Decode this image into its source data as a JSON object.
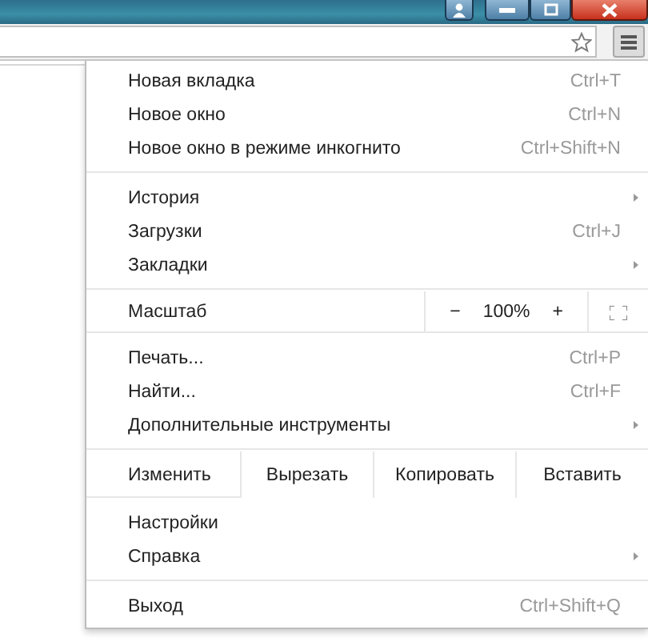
{
  "menu": {
    "groups": [
      {
        "entries": [
          {
            "kind": "item",
            "label": "Новая вкладка",
            "shortcut": "Ctrl+T",
            "submenu": false
          },
          {
            "kind": "item",
            "label": "Новое окно",
            "shortcut": "Ctrl+N",
            "submenu": false
          },
          {
            "kind": "item",
            "label": "Новое окно в режиме инкогнито",
            "shortcut": "Ctrl+Shift+N",
            "submenu": false
          }
        ]
      },
      {
        "entries": [
          {
            "kind": "item",
            "label": "История",
            "submenu": true
          },
          {
            "kind": "item",
            "label": "Загрузки",
            "shortcut": "Ctrl+J",
            "submenu": false
          },
          {
            "kind": "item",
            "label": "Закладки",
            "submenu": true
          }
        ]
      },
      {
        "entries": [
          {
            "kind": "zoom",
            "label": "Масштаб",
            "minus": "−",
            "value": "100%",
            "plus": "+"
          }
        ]
      },
      {
        "entries": [
          {
            "kind": "item",
            "label": "Печать...",
            "shortcut": "Ctrl+P",
            "submenu": false
          },
          {
            "kind": "item",
            "label": "Найти...",
            "shortcut": "Ctrl+F",
            "submenu": false
          },
          {
            "kind": "item",
            "label": "Дополнительные инструменты",
            "submenu": true
          }
        ]
      },
      {
        "entries": [
          {
            "kind": "edit",
            "label": "Изменить",
            "actions": [
              "Вырезать",
              "Копировать",
              "Вставить"
            ]
          }
        ]
      },
      {
        "entries": [
          {
            "kind": "item",
            "label": "Настройки",
            "submenu": false
          },
          {
            "kind": "item",
            "label": "Справка",
            "submenu": true
          }
        ]
      },
      {
        "entries": [
          {
            "kind": "item",
            "label": "Выход",
            "shortcut": "Ctrl+Shift+Q",
            "submenu": false
          }
        ]
      }
    ]
  }
}
